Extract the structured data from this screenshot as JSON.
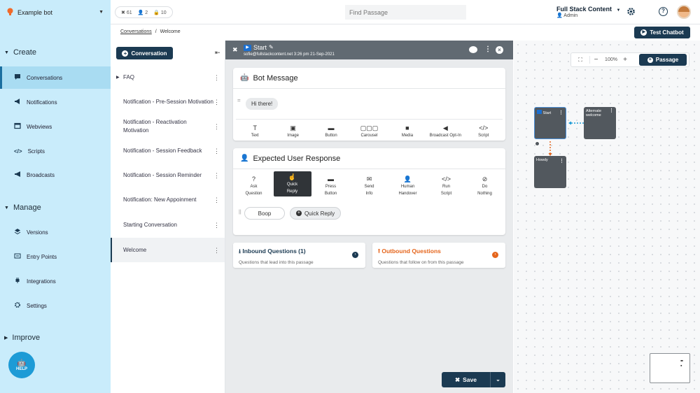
{
  "header": {
    "bot_name": "Example bot",
    "stats": {
      "passages": "61",
      "users": "2",
      "locks": "10"
    },
    "search_placeholder": "Find Passage",
    "account_name": "Full Stack Content",
    "account_role": "Admin"
  },
  "sidebar": {
    "sections": [
      {
        "label": "Create",
        "items": [
          {
            "label": "Conversations",
            "icon": "chat-icon",
            "active": true
          },
          {
            "label": "Notifications",
            "icon": "megaphone-icon"
          },
          {
            "label": "Webviews",
            "icon": "browser-icon"
          },
          {
            "label": "Scripts",
            "icon": "code-icon"
          },
          {
            "label": "Broadcasts",
            "icon": "bullhorn-icon"
          }
        ]
      },
      {
        "label": "Manage",
        "items": [
          {
            "label": "Versions",
            "icon": "layers-icon"
          },
          {
            "label": "Entry Points",
            "icon": "entry-icon"
          },
          {
            "label": "Integrations",
            "icon": "plug-icon"
          },
          {
            "label": "Settings",
            "icon": "gear-icon"
          }
        ]
      },
      {
        "label": "Improve",
        "items": []
      }
    ],
    "help_label": "HELP"
  },
  "breadcrumb": {
    "parent": "Conversations",
    "separator": "/",
    "current": "Welcome"
  },
  "test_button": "Test Chatbot",
  "conversation_list": {
    "new_button": "Conversation",
    "items": [
      {
        "label": "FAQ",
        "folder": true
      },
      {
        "label": "Notification - Pre-Session Motivation"
      },
      {
        "label": "Notification - Reactivation Motivation"
      },
      {
        "label": "Notification - Session Feedback"
      },
      {
        "label": "Notification - Session Reminder"
      },
      {
        "label": "Notification: New Appoinment"
      },
      {
        "label": "Starting Conversation"
      },
      {
        "label": "Welcome",
        "selected": true
      }
    ]
  },
  "editor": {
    "passage_title": "Start",
    "passage_meta": "sofie@fullstackcontent.net 3:26 pm 21-Sep-2021",
    "bot_message": {
      "title": "Bot Message",
      "message": "Hi there!",
      "tools": [
        "Text",
        "Image",
        "Button",
        "Carousel",
        "Media",
        "Broadcast Opt-In",
        "Script"
      ]
    },
    "user_response": {
      "title": "Expected User Response",
      "tools": [
        {
          "l1": "Ask",
          "l2": "Question"
        },
        {
          "l1": "Quick",
          "l2": "Reply",
          "active": true
        },
        {
          "l1": "Press",
          "l2": "Button"
        },
        {
          "l1": "Send",
          "l2": "Info"
        },
        {
          "l1": "Human",
          "l2": "Handover"
        },
        {
          "l1": "Run",
          "l2": "Script"
        },
        {
          "l1": "Do",
          "l2": "Nothing"
        }
      ],
      "reply_value": "Boop",
      "add_reply": "Quick Reply"
    },
    "inbound": {
      "title": "Inbound Questions (1)",
      "desc": "Questions that lead into this passage"
    },
    "outbound": {
      "title": "Outbound Questions",
      "desc": "Questions that follow on from this passage"
    },
    "save_label": "Save"
  },
  "canvas": {
    "zoom": "100%",
    "passage_button": "Passage",
    "nodes": [
      {
        "title": "Start"
      },
      {
        "title": "Alternate welcome"
      },
      {
        "title": "Howdy"
      }
    ]
  },
  "colors": {
    "primary": "#1b3a52",
    "sidebar": "#c9ecfb",
    "outbound": "#e5651c",
    "node": "#52585e"
  }
}
